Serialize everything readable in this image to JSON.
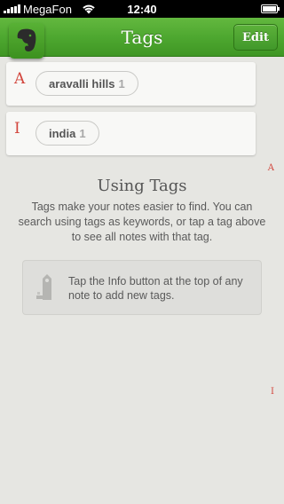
{
  "status_bar": {
    "carrier": "MegaFon",
    "time": "12:40"
  },
  "nav": {
    "title": "Tags",
    "edit_label": "Edit"
  },
  "sections": [
    {
      "letter": "A",
      "tags": [
        {
          "name": "aravalli hills",
          "count": "1"
        }
      ]
    },
    {
      "letter": "I",
      "tags": [
        {
          "name": "india",
          "count": "1"
        }
      ]
    }
  ],
  "index": [
    "A",
    "I"
  ],
  "info": {
    "title": "Using Tags",
    "body": "Tags make your notes easier to find. You can search using tags as keywords, or tap a tag above to see all notes with that tag.",
    "tip": "Tap the Info button at the top of any note to add new tags."
  },
  "colors": {
    "nav_green": "#4ea830",
    "index_red": "#d2453c",
    "background": "#e6e6e2"
  },
  "icons": {
    "logo": "evernote-elephant-icon",
    "tip": "tag-icon",
    "signal": "signal-strength-icon",
    "wifi": "wifi-icon",
    "battery": "battery-icon"
  }
}
